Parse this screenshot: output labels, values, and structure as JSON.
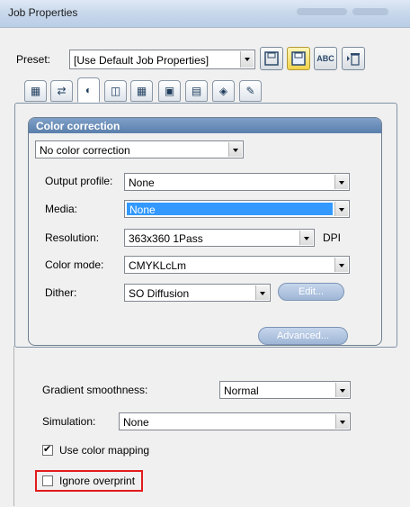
{
  "window": {
    "title": "Job Properties"
  },
  "preset": {
    "label": "Preset:",
    "value": "[Use Default Job Properties]"
  },
  "toolbar": {
    "buttons": [
      {
        "icon": "save-disk-icon"
      },
      {
        "icon": "save-disk-yellow-icon"
      },
      {
        "icon": "abc-icon",
        "text": "ABC"
      },
      {
        "icon": "delete-icon"
      }
    ]
  },
  "tabs": [
    {
      "icon": "printer-icon"
    },
    {
      "icon": "layout-icon"
    },
    {
      "icon": "color-icon"
    },
    {
      "icon": "film-icon"
    },
    {
      "icon": "grid-icon"
    },
    {
      "icon": "crop-icon"
    },
    {
      "icon": "swatch-icon"
    },
    {
      "icon": "layers-icon"
    },
    {
      "icon": "pen-icon"
    }
  ],
  "color_correction": {
    "header": "Color correction",
    "mode": "No color correction",
    "output_profile": {
      "label": "Output profile:",
      "value": "None"
    },
    "media": {
      "label": "Media:",
      "value": "None"
    },
    "resolution": {
      "label": "Resolution:",
      "value": "363x360 1Pass",
      "unit": "DPI"
    },
    "color_mode": {
      "label": "Color mode:",
      "value": "CMYKLcLm"
    },
    "dither": {
      "label": "Dither:",
      "value": "SO Diffusion"
    },
    "edit_button": "Edit...",
    "advanced_button": "Advanced..."
  },
  "gradient": {
    "label": "Gradient smoothness:",
    "value": "Normal"
  },
  "simulation": {
    "label": "Simulation:",
    "value": "None"
  },
  "use_color_mapping": {
    "label": "Use color mapping",
    "checked": true
  },
  "ignore_overprint": {
    "label": "Ignore overprint",
    "checked": false
  },
  "colors": {
    "accent": "#3399ff",
    "highlight_box": "#e31b1b"
  }
}
